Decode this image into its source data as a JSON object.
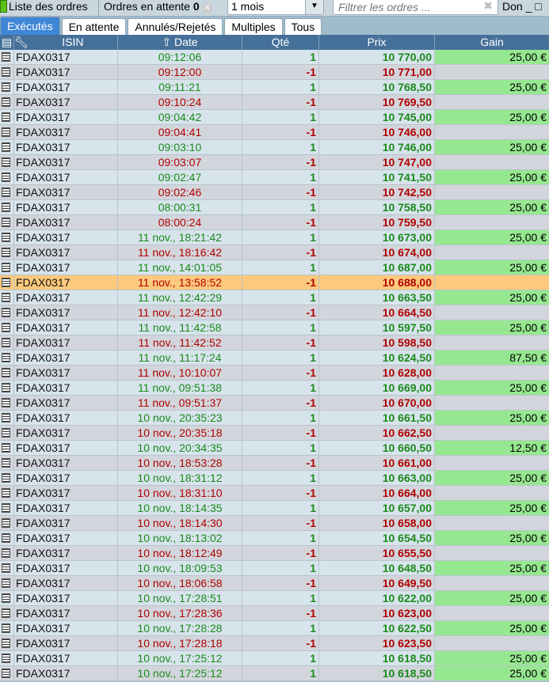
{
  "toolbar": {
    "orders_list": "Liste des ordres",
    "pending_label": "Ordres en attente",
    "pending_count": "0",
    "period": "1 mois",
    "filter_placeholder": "Filtrer les ordres ...",
    "extra": "Don"
  },
  "tabs": [
    "Exécutés",
    "En attente",
    "Annulés/Rejetés",
    "Multiples",
    "Tous"
  ],
  "columns": {
    "isin": "ISIN",
    "date": "Date",
    "qty": "Qté",
    "price": "Prix",
    "gain": "Gain"
  },
  "colors": {
    "buy": "#1a8a1a",
    "sell": "#b00000",
    "gain_bg": "#96e890",
    "highlight": "#fdc97c",
    "header": "#45709a"
  },
  "rows": [
    [
      "FDAX0317",
      "09:12:06",
      "1",
      "10 770,00",
      "25,00 €"
    ],
    [
      "FDAX0317",
      "09:12:00",
      "-1",
      "10 771,00",
      ""
    ],
    [
      "FDAX0317",
      "09:11:21",
      "1",
      "10 768,50",
      "25,00 €"
    ],
    [
      "FDAX0317",
      "09:10:24",
      "-1",
      "10 769,50",
      ""
    ],
    [
      "FDAX0317",
      "09:04:42",
      "1",
      "10 745,00",
      "25,00 €"
    ],
    [
      "FDAX0317",
      "09:04:41",
      "-1",
      "10 746,00",
      ""
    ],
    [
      "FDAX0317",
      "09:03:10",
      "1",
      "10 746,00",
      "25,00 €"
    ],
    [
      "FDAX0317",
      "09:03:07",
      "-1",
      "10 747,00",
      ""
    ],
    [
      "FDAX0317",
      "09:02:47",
      "1",
      "10 741,50",
      "25,00 €"
    ],
    [
      "FDAX0317",
      "09:02:46",
      "-1",
      "10 742,50",
      ""
    ],
    [
      "FDAX0317",
      "08:00:31",
      "1",
      "10 758,50",
      "25,00 €"
    ],
    [
      "FDAX0317",
      "08:00:24",
      "-1",
      "10 759,50",
      ""
    ],
    [
      "FDAX0317",
      "11 nov., 18:21:42",
      "1",
      "10 673,00",
      "25,00 €"
    ],
    [
      "FDAX0317",
      "11 nov., 18:16:42",
      "-1",
      "10 674,00",
      ""
    ],
    [
      "FDAX0317",
      "11 nov., 14:01:05",
      "1",
      "10 687,00",
      "25,00 €"
    ],
    [
      "FDAX0317",
      "11 nov., 13:58:52",
      "-1",
      "10 688,00",
      ""
    ],
    [
      "FDAX0317",
      "11 nov., 12:42:29",
      "1",
      "10 663,50",
      "25,00 €"
    ],
    [
      "FDAX0317",
      "11 nov., 12:42:10",
      "-1",
      "10 664,50",
      ""
    ],
    [
      "FDAX0317",
      "11 nov., 11:42:58",
      "1",
      "10 597,50",
      "25,00 €"
    ],
    [
      "FDAX0317",
      "11 nov., 11:42:52",
      "-1",
      "10 598,50",
      ""
    ],
    [
      "FDAX0317",
      "11 nov., 11:17:24",
      "1",
      "10 624,50",
      "87,50 €"
    ],
    [
      "FDAX0317",
      "11 nov., 10:10:07",
      "-1",
      "10 628,00",
      ""
    ],
    [
      "FDAX0317",
      "11 nov., 09:51:38",
      "1",
      "10 669,00",
      "25,00 €"
    ],
    [
      "FDAX0317",
      "11 nov., 09:51:37",
      "-1",
      "10 670,00",
      ""
    ],
    [
      "FDAX0317",
      "10 nov., 20:35:23",
      "1",
      "10 661,50",
      "25,00 €"
    ],
    [
      "FDAX0317",
      "10 nov., 20:35:18",
      "-1",
      "10 662,50",
      ""
    ],
    [
      "FDAX0317",
      "10 nov., 20:34:35",
      "1",
      "10 660,50",
      "12,50 €"
    ],
    [
      "FDAX0317",
      "10 nov., 18:53:28",
      "-1",
      "10 661,00",
      ""
    ],
    [
      "FDAX0317",
      "10 nov., 18:31:12",
      "1",
      "10 663,00",
      "25,00 €"
    ],
    [
      "FDAX0317",
      "10 nov., 18:31:10",
      "-1",
      "10 664,00",
      ""
    ],
    [
      "FDAX0317",
      "10 nov., 18:14:35",
      "1",
      "10 657,00",
      "25,00 €"
    ],
    [
      "FDAX0317",
      "10 nov., 18:14:30",
      "-1",
      "10 658,00",
      ""
    ],
    [
      "FDAX0317",
      "10 nov., 18:13:02",
      "1",
      "10 654,50",
      "25,00 €"
    ],
    [
      "FDAX0317",
      "10 nov., 18:12:49",
      "-1",
      "10 655,50",
      ""
    ],
    [
      "FDAX0317",
      "10 nov., 18:09:53",
      "1",
      "10 648,50",
      "25,00 €"
    ],
    [
      "FDAX0317",
      "10 nov., 18:06:58",
      "-1",
      "10 649,50",
      ""
    ],
    [
      "FDAX0317",
      "10 nov., 17:28:51",
      "1",
      "10 622,00",
      "25,00 €"
    ],
    [
      "FDAX0317",
      "10 nov., 17:28:36",
      "-1",
      "10 623,00",
      ""
    ],
    [
      "FDAX0317",
      "10 nov., 17:28:28",
      "1",
      "10 622,50",
      "25,00 €"
    ],
    [
      "FDAX0317",
      "10 nov., 17:28:18",
      "-1",
      "10 623,50",
      ""
    ],
    [
      "FDAX0317",
      "10 nov., 17:25:12",
      "1",
      "10 618,50",
      "25,00 €"
    ],
    [
      "FDAX0317",
      "10 nov., 17:25:12",
      "1",
      "10 618,50",
      "25,00 €"
    ]
  ],
  "highlighted_row": 15
}
